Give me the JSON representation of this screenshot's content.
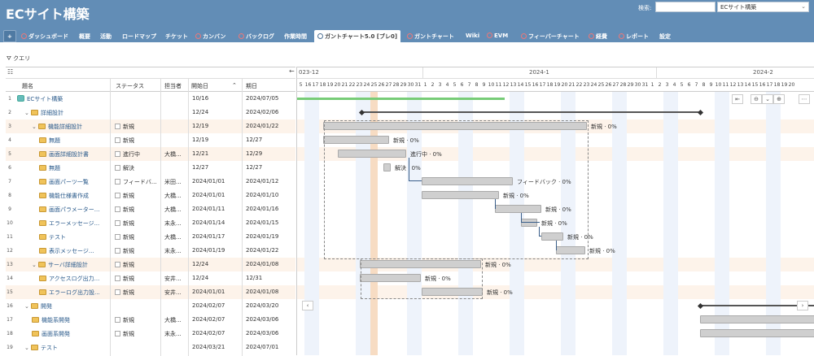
{
  "header": {
    "title": "ECサイト構築",
    "search_label": "検索:",
    "search_placeholder": "",
    "project_select": "ECサイト構築"
  },
  "tabs": [
    {
      "label": "+"
    },
    {
      "label": "ダッシュボード"
    },
    {
      "label": "概要"
    },
    {
      "label": "活動"
    },
    {
      "label": "ロードマップ"
    },
    {
      "label": "チケット"
    },
    {
      "label": "カンバン"
    },
    {
      "label": "バックログ"
    },
    {
      "label": "作業時間"
    },
    {
      "label": "ガントチャート5.0 [ブレ0]"
    },
    {
      "label": "ガントチャート"
    },
    {
      "label": "Wiki"
    },
    {
      "label": "EVM"
    },
    {
      "label": "フィーバーチャート"
    },
    {
      "label": "経費"
    },
    {
      "label": "レポート"
    },
    {
      "label": "設定"
    }
  ],
  "query": {
    "label": "クエリ"
  },
  "table": {
    "headers": {
      "subject": "題名",
      "status": "ステータス",
      "assignee": "担当者",
      "start": "開始日",
      "due": "期日"
    },
    "rows": [
      {
        "num": "1",
        "subject": "ECサイト構築",
        "status": "",
        "assignee": "",
        "start": "10/16",
        "due": "2024/07/05"
      },
      {
        "num": "2",
        "subject": "詳細設計",
        "status": "",
        "assignee": "",
        "start": "12/24",
        "due": "2024/02/06"
      },
      {
        "num": "3",
        "subject": "機能詳細設計",
        "status": "新規",
        "assignee": "",
        "start": "12/19",
        "due": "2024/01/22"
      },
      {
        "num": "4",
        "subject": "無題",
        "status": "新規",
        "assignee": "",
        "start": "12/19",
        "due": "12/27"
      },
      {
        "num": "5",
        "subject": "画面詳細設計書",
        "status": "進行中",
        "assignee": "大橋...",
        "start": "12/21",
        "due": "12/29"
      },
      {
        "num": "6",
        "subject": "無題",
        "status": "解決",
        "assignee": "",
        "start": "12/27",
        "due": "12/27"
      },
      {
        "num": "7",
        "subject": "画面パーツ一覧",
        "status": "フィードバ...",
        "assignee": "米田...",
        "start": "2024/01/01",
        "due": "2024/01/12"
      },
      {
        "num": "8",
        "subject": "機能仕様書作成",
        "status": "新規",
        "assignee": "大橋...",
        "start": "2024/01/01",
        "due": "2024/01/10"
      },
      {
        "num": "9",
        "subject": "画面パラメーター...",
        "status": "新規",
        "assignee": "大橋...",
        "start": "2024/01/11",
        "due": "2024/01/16"
      },
      {
        "num": "10",
        "subject": "エラーメッセージ...",
        "status": "新規",
        "assignee": "末永...",
        "start": "2024/01/14",
        "due": "2024/01/15"
      },
      {
        "num": "11",
        "subject": "テスト",
        "status": "新規",
        "assignee": "大橋...",
        "start": "2024/01/17",
        "due": "2024/01/19"
      },
      {
        "num": "12",
        "subject": "表示メッセージ...",
        "status": "新規",
        "assignee": "末永...",
        "start": "2024/01/19",
        "due": "2024/01/22"
      },
      {
        "num": "13",
        "subject": "サーバ詳細設計",
        "status": "新規",
        "assignee": "",
        "start": "12/24",
        "due": "2024/01/08"
      },
      {
        "num": "14",
        "subject": "アクセスログ出力...",
        "status": "新規",
        "assignee": "安井...",
        "start": "12/24",
        "due": "12/31"
      },
      {
        "num": "15",
        "subject": "エラーログ出力設...",
        "status": "新規",
        "assignee": "安井...",
        "start": "2024/01/01",
        "due": "2024/01/08"
      },
      {
        "num": "16",
        "subject": "開発",
        "status": "",
        "assignee": "",
        "start": "2024/02/07",
        "due": "2024/03/20"
      },
      {
        "num": "17",
        "subject": "機能系開発",
        "status": "新規",
        "assignee": "大橋...",
        "start": "2024/02/07",
        "due": "2024/03/06"
      },
      {
        "num": "18",
        "subject": "画面系開発",
        "status": "新規",
        "assignee": "末永...",
        "start": "2024/02/07",
        "due": "2024/03/06"
      },
      {
        "num": "19",
        "subject": "テスト",
        "status": "",
        "assignee": "",
        "start": "2024/03/21",
        "due": "2024/07/01"
      }
    ]
  },
  "gantt": {
    "months": [
      "023-12",
      "2024-1",
      "2024-2"
    ],
    "days": [
      "5",
      "16",
      "17",
      "18",
      "19",
      "20",
      "21",
      "22",
      "23",
      "24",
      "25",
      "26",
      "27",
      "28",
      "29",
      "30",
      "31",
      "1",
      "2",
      "3",
      "4",
      "5",
      "6",
      "7",
      "8",
      "9",
      "10",
      "11",
      "12",
      "13",
      "14",
      "15",
      "16",
      "17",
      "18",
      "19",
      "20",
      "21",
      "22",
      "23",
      "24",
      "25",
      "26",
      "27",
      "28",
      "29",
      "30",
      "31",
      "1",
      "2",
      "3",
      "4",
      "5",
      "6",
      "7",
      "8",
      "9",
      "10",
      "11",
      "12",
      "13",
      "14",
      "15",
      "16",
      "17",
      "18",
      "19",
      "20"
    ],
    "bar_labels": [
      "新規 · 0%",
      "新規 · 0%",
      "進行中 · 0%",
      "解決 · 0%",
      "フィードバック · 0%",
      "新規 · 0%",
      "新規 · 0%",
      "新規 · 0%",
      "新規 · 0%",
      "新規 · 0%",
      "新規 · 0%",
      "新規 · 0%",
      "新規 · 0%"
    ]
  }
}
